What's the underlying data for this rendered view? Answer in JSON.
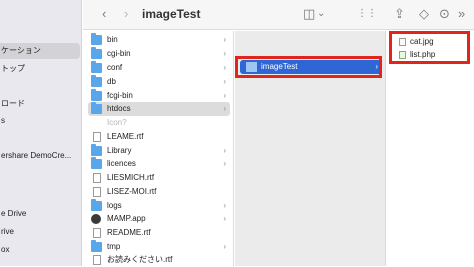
{
  "toolbar": {
    "title": "imageTest",
    "back": "‹",
    "forward": "›",
    "view_icon": "◫",
    "view_chevron": "⌄",
    "group_icon": "⋮⋮",
    "share_icon": "⇪",
    "tag_icon": "◇",
    "action_icon": "⊙",
    "more": "»"
  },
  "sidebar": {
    "items": [
      {
        "label": "ケーション"
      },
      {
        "label": "トップ"
      },
      {
        "label": ""
      },
      {
        "label": "ロード"
      },
      {
        "label": "s"
      },
      {
        "label": "ershare DemoCre..."
      },
      {
        "label": "e Drive"
      },
      {
        "label": "rive"
      },
      {
        "label": "ox"
      }
    ]
  },
  "column1": {
    "items": [
      {
        "label": "bin",
        "type": "folder"
      },
      {
        "label": "cgi-bin",
        "type": "folder"
      },
      {
        "label": "conf",
        "type": "folder"
      },
      {
        "label": "db",
        "type": "folder"
      },
      {
        "label": "fcgi-bin",
        "type": "folder"
      },
      {
        "label": "htdocs",
        "type": "folder"
      },
      {
        "label": "Icon?",
        "type": "ghost"
      },
      {
        "label": "LEAME.rtf",
        "type": "doc"
      },
      {
        "label": "Library",
        "type": "folder"
      },
      {
        "label": "licences",
        "type": "folder"
      },
      {
        "label": "LIESMICH.rtf",
        "type": "doc"
      },
      {
        "label": "LISEZ-MOI.rtf",
        "type": "doc"
      },
      {
        "label": "logs",
        "type": "folder"
      },
      {
        "label": "MAMP.app",
        "type": "app"
      },
      {
        "label": "README.rtf",
        "type": "doc"
      },
      {
        "label": "tmp",
        "type": "folder"
      },
      {
        "label": "お読みください.rtf",
        "type": "doc"
      }
    ],
    "chevron": "›"
  },
  "column2": {
    "selected_label": "imageTest",
    "chevron": "›"
  },
  "column3": {
    "files": [
      {
        "label": "cat.jpg"
      },
      {
        "label": "list.php"
      }
    ]
  },
  "colors": {
    "selection_blue": "#2f66d6",
    "folder_blue": "#5aa6ea",
    "highlight_red": "#e0251b"
  }
}
